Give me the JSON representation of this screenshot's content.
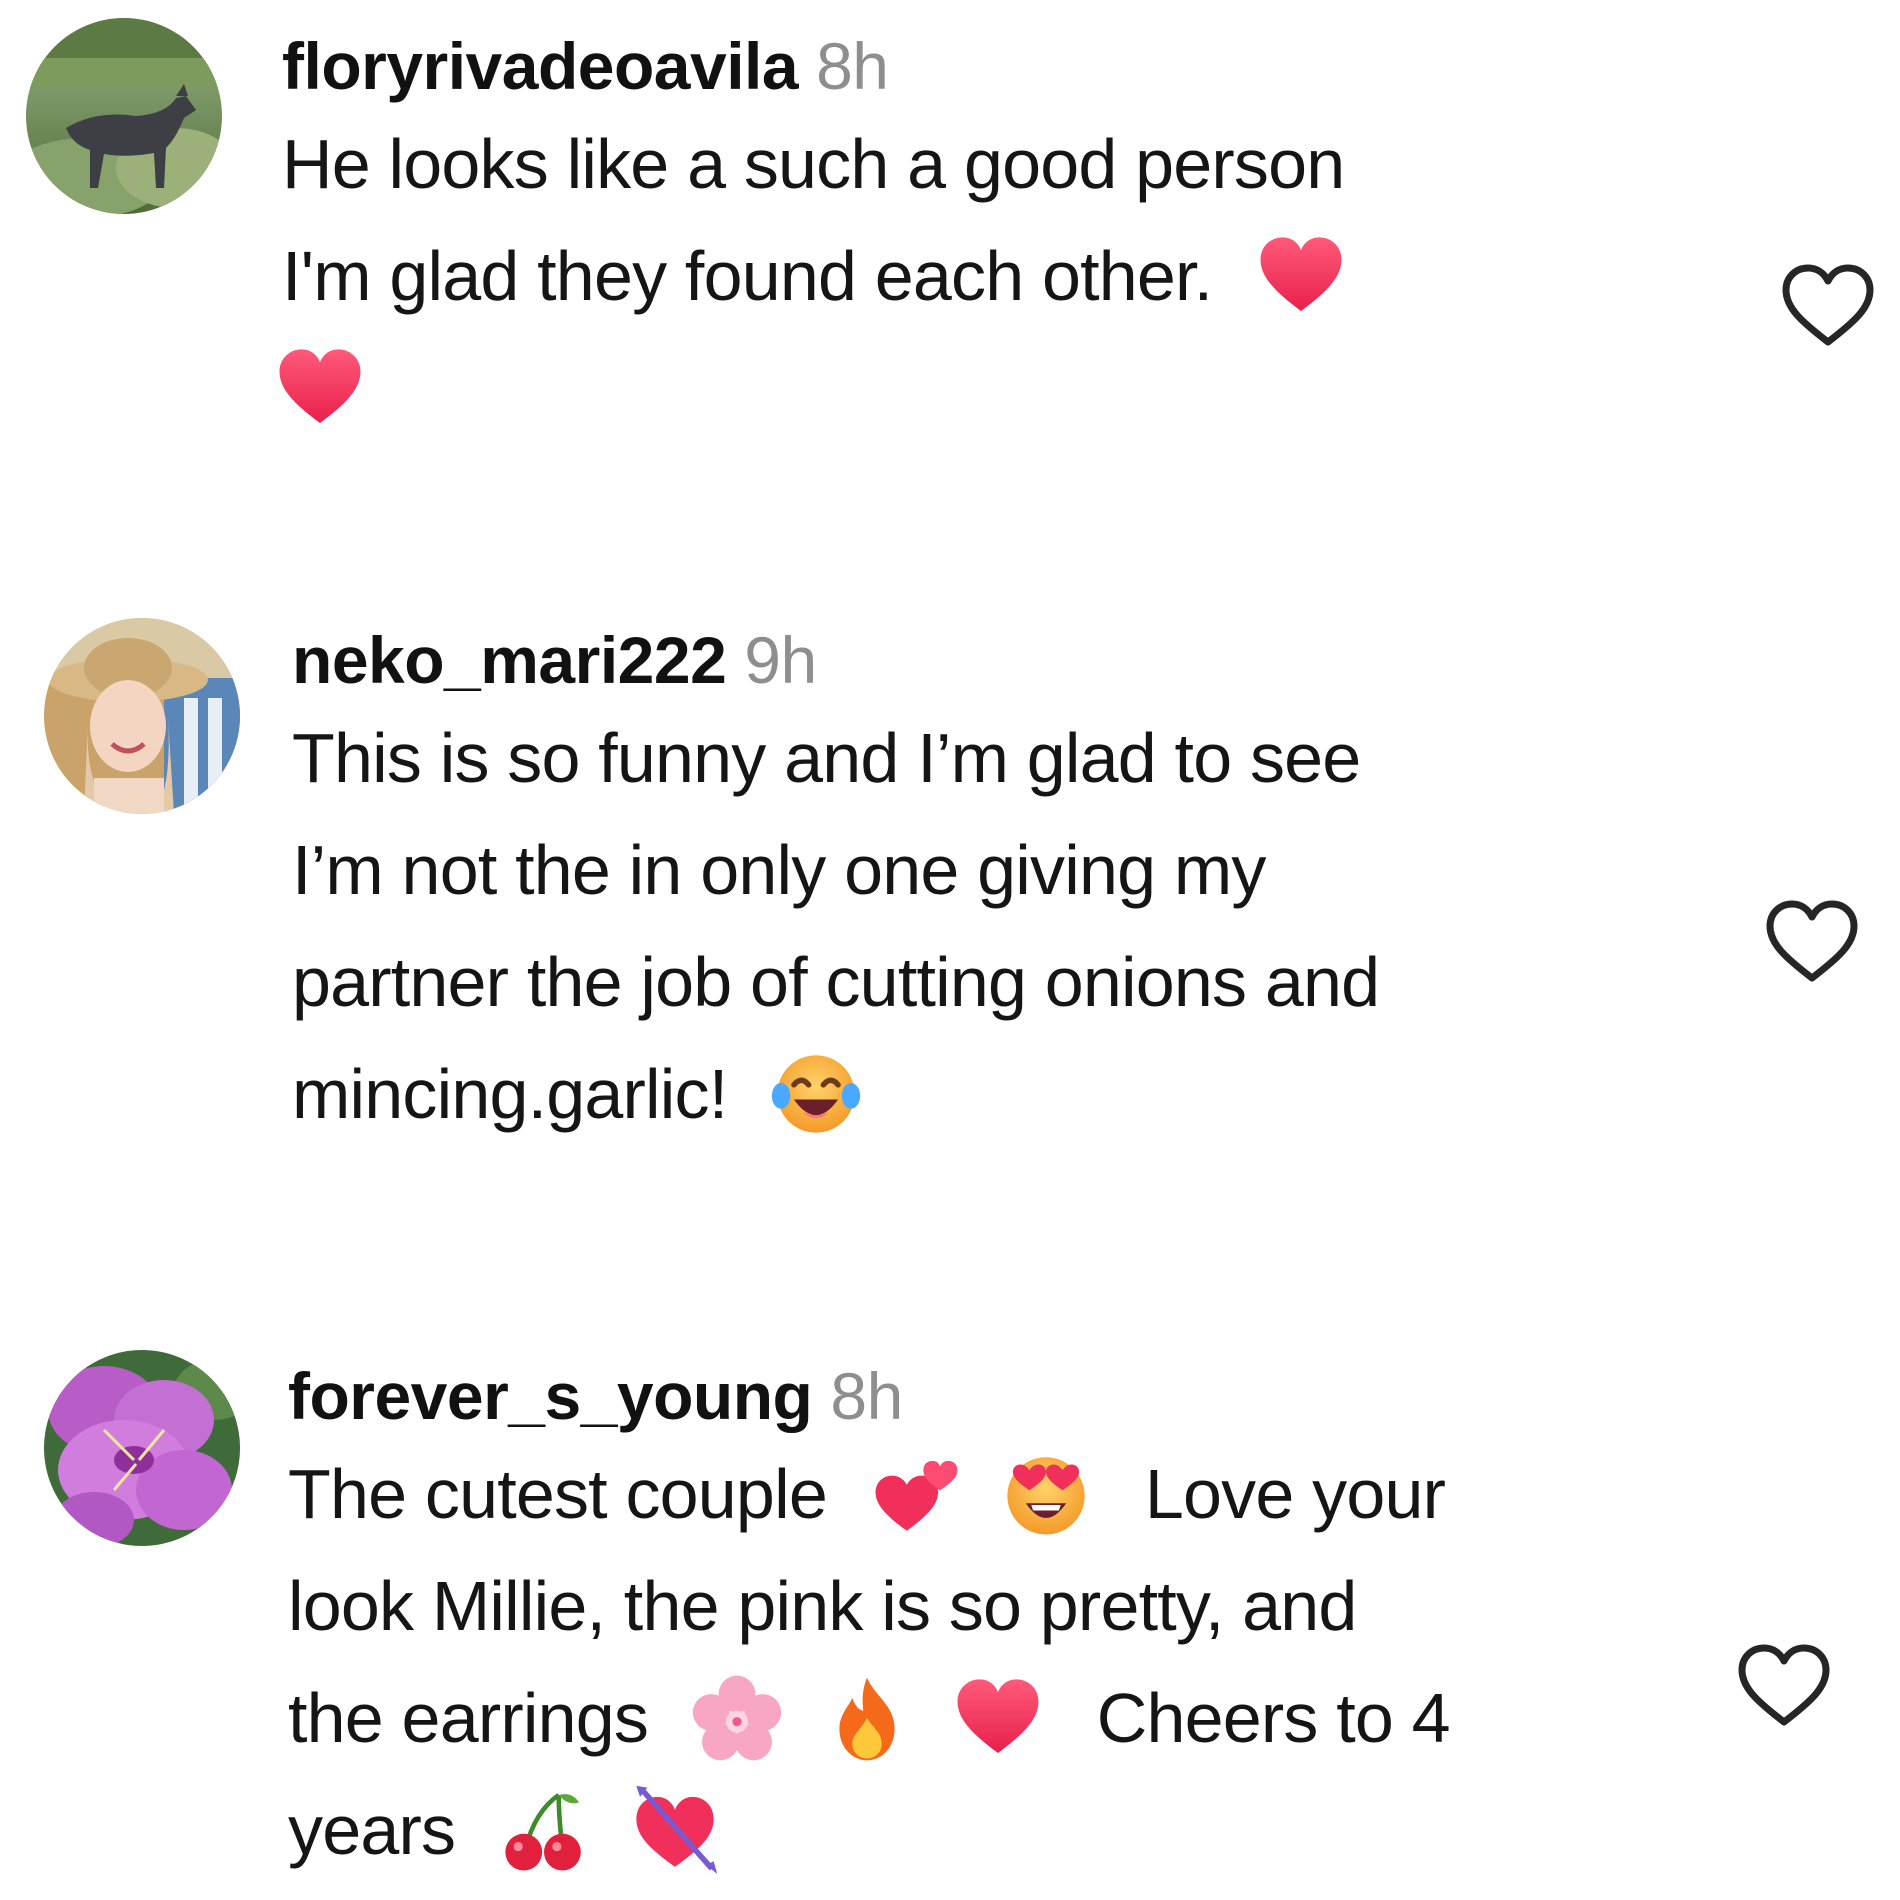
{
  "comments": [
    {
      "username": "floryrivadeoavila",
      "time": "8h",
      "lines": [
        "He looks like a such a good person",
        "I'm glad they found each other."
      ],
      "avatar_icon": "horse-avatar",
      "emojis": [
        "red-heart",
        "red-heart"
      ]
    },
    {
      "username": "neko_mari222",
      "time": "9h",
      "lines": [
        "This is so funny and I’m glad to see",
        "I’m not the in only one giving my",
        "partner the job of cutting onions and",
        "mincing.garlic!"
      ],
      "avatar_icon": "woman-with-hat-avatar",
      "emojis": [
        "tears-of-joy"
      ]
    },
    {
      "username": "forever_s_young",
      "time": "8h",
      "lines": [
        "The cutest couple",
        "Love your",
        "look Millie, the pink is so pretty, and",
        "the earrings",
        "Cheers to 4",
        "years"
      ],
      "avatar_icon": "pink-flower-avatar",
      "emojis": [
        "two-hearts",
        "heart-eyes",
        "cherry-blossom",
        "fire",
        "red-heart",
        "cherries",
        "heart-with-arrow"
      ]
    }
  ],
  "colors": {
    "text": "#151515",
    "timestamp": "#8e8e8e",
    "like_icon": "#262626",
    "heart": "#f0305a"
  }
}
